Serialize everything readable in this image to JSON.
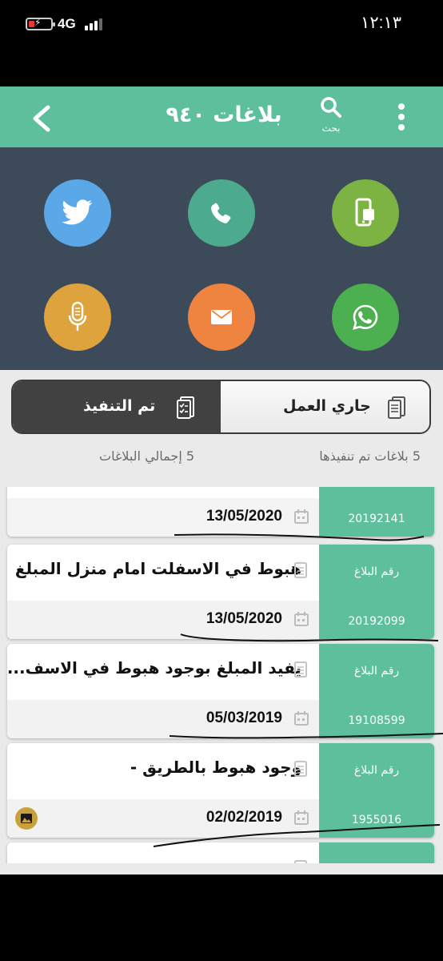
{
  "status_bar": {
    "network": "4G",
    "time": "١٢:١٣"
  },
  "app_bar": {
    "title": "بلاغات ٩٤٠",
    "search_label": "بحث"
  },
  "colors": {
    "accent": "#5dbf9c",
    "dark_panel": "#3c4a59"
  },
  "contact_actions": [
    {
      "icon": "twitter-icon",
      "color": "#5aa8e8"
    },
    {
      "icon": "phone-icon",
      "color": "#4cab8e"
    },
    {
      "icon": "mobile-app-icon",
      "color": "#7cb342"
    },
    {
      "icon": "microphone-icon",
      "color": "#dea33c"
    },
    {
      "icon": "mail-icon",
      "color": "#ef8440"
    },
    {
      "icon": "whatsapp-icon",
      "color": "#4caf50"
    }
  ],
  "tabs": {
    "done": "تم التنفيذ",
    "in_progress": "جاري العمل"
  },
  "stats": {
    "total_label": "5  إجمالي البلاغات",
    "done_label": "5  بلاغات تم تنفيذها"
  },
  "report_number_label": "رقم البلاغ",
  "reports": [
    {
      "number": "20192141",
      "description": "",
      "date": "13/05/2020"
    },
    {
      "number": "20192099",
      "description": "هبوط في الاسفلت امام منزل المبلغ",
      "date": "13/05/2020"
    },
    {
      "number": "19108599",
      "description": "يفيد المبلغ بوجود هبوط في الاسف...",
      "date": "05/03/2019"
    },
    {
      "number": "1955016",
      "description": "وجود هبوط بالطريق -",
      "date": "02/02/2019",
      "has_image": true
    }
  ]
}
